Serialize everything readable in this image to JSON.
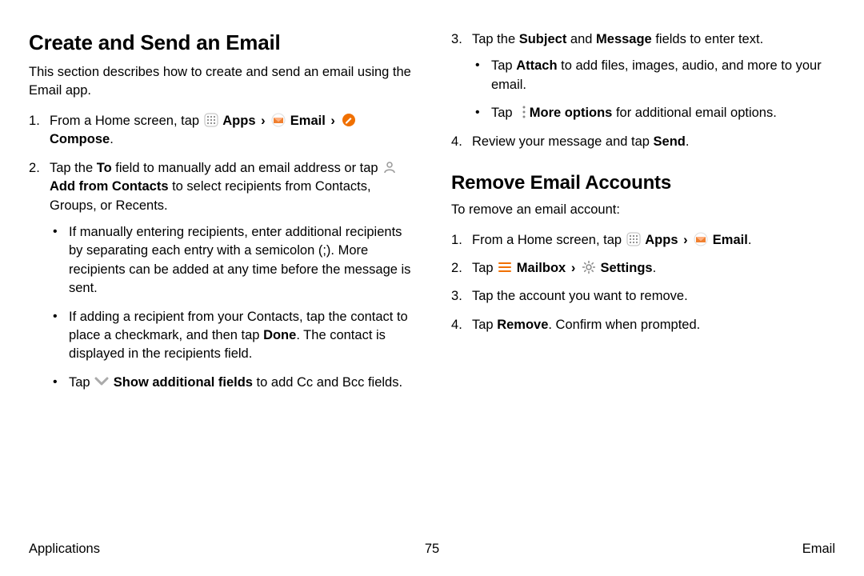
{
  "left": {
    "h1": "Create and Send an Email",
    "intro": "This section describes how to create and send an email using the Email app.",
    "step1_a": "From a Home screen, tap ",
    "apps": "Apps",
    "email": "Email",
    "compose": "Compose",
    "period": ".",
    "step2_a": "Tap the ",
    "to_field": "To",
    "step2_b": " field to manually add an email address or tap ",
    "add_from_contacts": "Add from Contacts",
    "step2_c": " to select recipients from Contacts, Groups, or Recents.",
    "b1": "If manually entering recipients, enter additional recipients by separating each entry with a semicolon (;). More recipients can be added at any time before the message is sent.",
    "b2_a": "If adding a recipient from your Contacts, tap the contact to place a checkmark, and then tap ",
    "done": "Done",
    "b2_b": ". The contact is displayed in the recipients field.",
    "b3_a": "Tap ",
    "show_additional": "Show additional fields",
    "b3_b": " to add Cc and Bcc fields."
  },
  "right": {
    "step3_a": "Tap the ",
    "subject": "Subject",
    "and": " and ",
    "message": "Message",
    "step3_b": " fields to enter text.",
    "rb1_a": "Tap ",
    "attach": "Attach",
    "rb1_b": " to add files, images, audio, and more to your email.",
    "rb2_a": "Tap ",
    "more_options": "More options",
    "rb2_b": " for additional email options.",
    "step4_a": "Review your message and tap ",
    "send": "Send",
    "period": ".",
    "h2": "Remove Email Accounts",
    "intro2": "To remove an email account:",
    "r1_a": "From a Home screen, tap ",
    "apps": "Apps",
    "email": "Email",
    "r2_a": "Tap ",
    "mailbox": "Mailbox",
    "settings": "Settings",
    "r3": "Tap the account you want to remove.",
    "r4_a": "Tap ",
    "remove": "Remove",
    "r4_b": ". Confirm when prompted."
  },
  "chevron": "›",
  "footer": {
    "left": "Applications",
    "page": "75",
    "right": "Email"
  }
}
